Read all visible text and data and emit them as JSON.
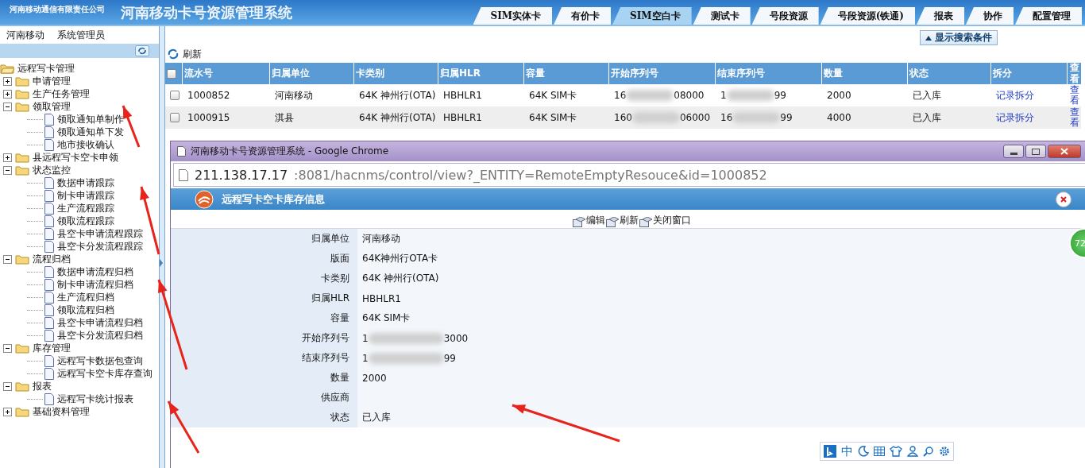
{
  "header": {
    "company": "河南移动通信有限责任公司",
    "title": "河南移动卡号资源管理系统"
  },
  "tabs": [
    {
      "label": "SIM实体卡",
      "selected": false
    },
    {
      "label": "有价卡",
      "selected": false
    },
    {
      "label": "SIM空白卡",
      "selected": true
    },
    {
      "label": "测试卡",
      "selected": false
    },
    {
      "label": "号段资源",
      "selected": false
    },
    {
      "label": "号段资源(铁通)",
      "selected": false
    },
    {
      "label": "报表",
      "selected": false
    },
    {
      "label": "协作",
      "selected": false
    },
    {
      "label": "配置管理",
      "selected": false
    }
  ],
  "user_bar": {
    "org": "河南移动",
    "user": "系统管理员"
  },
  "tree": [
    {
      "label": "远程写卡管理",
      "expanded": true,
      "children": [
        {
          "label": "申请管理",
          "expanded": false
        },
        {
          "label": "生产任务管理",
          "expanded": false
        },
        {
          "label": "领取管理",
          "expanded": true,
          "children": [
            {
              "label": "领取通知单制作"
            },
            {
              "label": "领取通知单下发"
            },
            {
              "label": "地市接收确认"
            }
          ]
        },
        {
          "label": "县远程写卡空卡申领",
          "expanded": false
        },
        {
          "label": "状态监控",
          "expanded": true,
          "children": [
            {
              "label": "数据申请跟踪"
            },
            {
              "label": "制卡申请跟踪"
            },
            {
              "label": "生产流程跟踪"
            },
            {
              "label": "领取流程跟踪"
            },
            {
              "label": "县空卡申请流程跟踪"
            },
            {
              "label": "县空卡分发流程跟踪"
            }
          ]
        },
        {
          "label": "流程归档",
          "expanded": true,
          "children": [
            {
              "label": "数据申请流程归档"
            },
            {
              "label": "制卡申请流程归档"
            },
            {
              "label": "生产流程归档"
            },
            {
              "label": "领取流程归档"
            },
            {
              "label": "县空卡申请流程归档"
            },
            {
              "label": "县空卡分发流程归档"
            }
          ]
        },
        {
          "label": "库存管理",
          "expanded": true,
          "children": [
            {
              "label": "远程写卡数据包查询"
            },
            {
              "label": "远程写卡空卡库存查询"
            }
          ]
        },
        {
          "label": "报表",
          "expanded": true,
          "children": [
            {
              "label": "远程写卡统计报表"
            }
          ]
        },
        {
          "label": "基础资料管理",
          "expanded": false
        }
      ]
    }
  ],
  "search_toggle": "显示搜索条件",
  "refresh": "刷新",
  "table": {
    "select_all": {
      "checked": false
    },
    "columns": [
      "流水号",
      "归属单位",
      "卡类别",
      "归属HLR",
      "容量",
      "开始序列号",
      "结束序列号",
      "数量",
      "状态",
      "拆分",
      "查看"
    ],
    "rows": [
      {
        "selected": false,
        "cells": [
          {
            "kind": "text",
            "text": "1000852"
          },
          {
            "kind": "text",
            "text": "河南移动"
          },
          {
            "kind": "text",
            "text": "64K 神州行(OTA)"
          },
          {
            "kind": "text",
            "text": "HBHLR1"
          },
          {
            "kind": "text",
            "text": "64K SIM卡"
          },
          {
            "kind": "redacted",
            "head": "16",
            "tail": "08000"
          },
          {
            "kind": "redacted",
            "head": "1",
            "tail": "99"
          },
          {
            "kind": "text",
            "text": "2000"
          },
          {
            "kind": "text",
            "text": "已入库"
          },
          {
            "kind": "link",
            "text": "记录拆分"
          },
          {
            "kind": "link",
            "text": "查看"
          }
        ]
      },
      {
        "selected": false,
        "cells": [
          {
            "kind": "text",
            "text": "1000915"
          },
          {
            "kind": "text",
            "text": "淇县"
          },
          {
            "kind": "text",
            "text": "64K 神州行(OTA)"
          },
          {
            "kind": "text",
            "text": "HBHLR1"
          },
          {
            "kind": "text",
            "text": "64K SIM卡"
          },
          {
            "kind": "redacted",
            "head": "160",
            "tail": "06000"
          },
          {
            "kind": "redacted",
            "head": "16",
            "tail": "99"
          },
          {
            "kind": "text",
            "text": "4000"
          },
          {
            "kind": "text",
            "text": "已入库"
          },
          {
            "kind": "link",
            "text": "记录拆分"
          },
          {
            "kind": "link",
            "text": "查看"
          }
        ]
      }
    ]
  },
  "popup": {
    "window_title": "河南移动卡号资源管理系统 - Google Chrome",
    "url_host": "211.138.17.17",
    "url_rest": ":8081/hacnms/control/view?_ENTITY=RemoteEmptyResouce&id=1000852",
    "heading": "远程写卡空卡库存信息",
    "actions": [
      "编辑",
      "刷新",
      "关闭窗口"
    ],
    "fields": [
      {
        "label": "归属单位",
        "kind": "text",
        "value": "河南移动"
      },
      {
        "label": "版面",
        "kind": "text",
        "value": "64K神州行OTA卡"
      },
      {
        "label": "卡类别",
        "kind": "text",
        "value": "64K 神州行(OTA)"
      },
      {
        "label": "归属HLR",
        "kind": "text",
        "value": "HBHLR1"
      },
      {
        "label": "容量",
        "kind": "text",
        "value": "64K SIM卡"
      },
      {
        "label": "开始序列号",
        "kind": "redacted",
        "head": "1",
        "tail": "3000"
      },
      {
        "label": "结束序列号",
        "kind": "redacted",
        "head": "1",
        "tail": "99"
      },
      {
        "label": "数量",
        "kind": "text",
        "value": "2000"
      },
      {
        "label": "供应商",
        "kind": "text"
      },
      {
        "label": "状态",
        "kind": "text",
        "value": "已入库"
      }
    ]
  },
  "badge": "72",
  "ime": {
    "mode": "中"
  }
}
